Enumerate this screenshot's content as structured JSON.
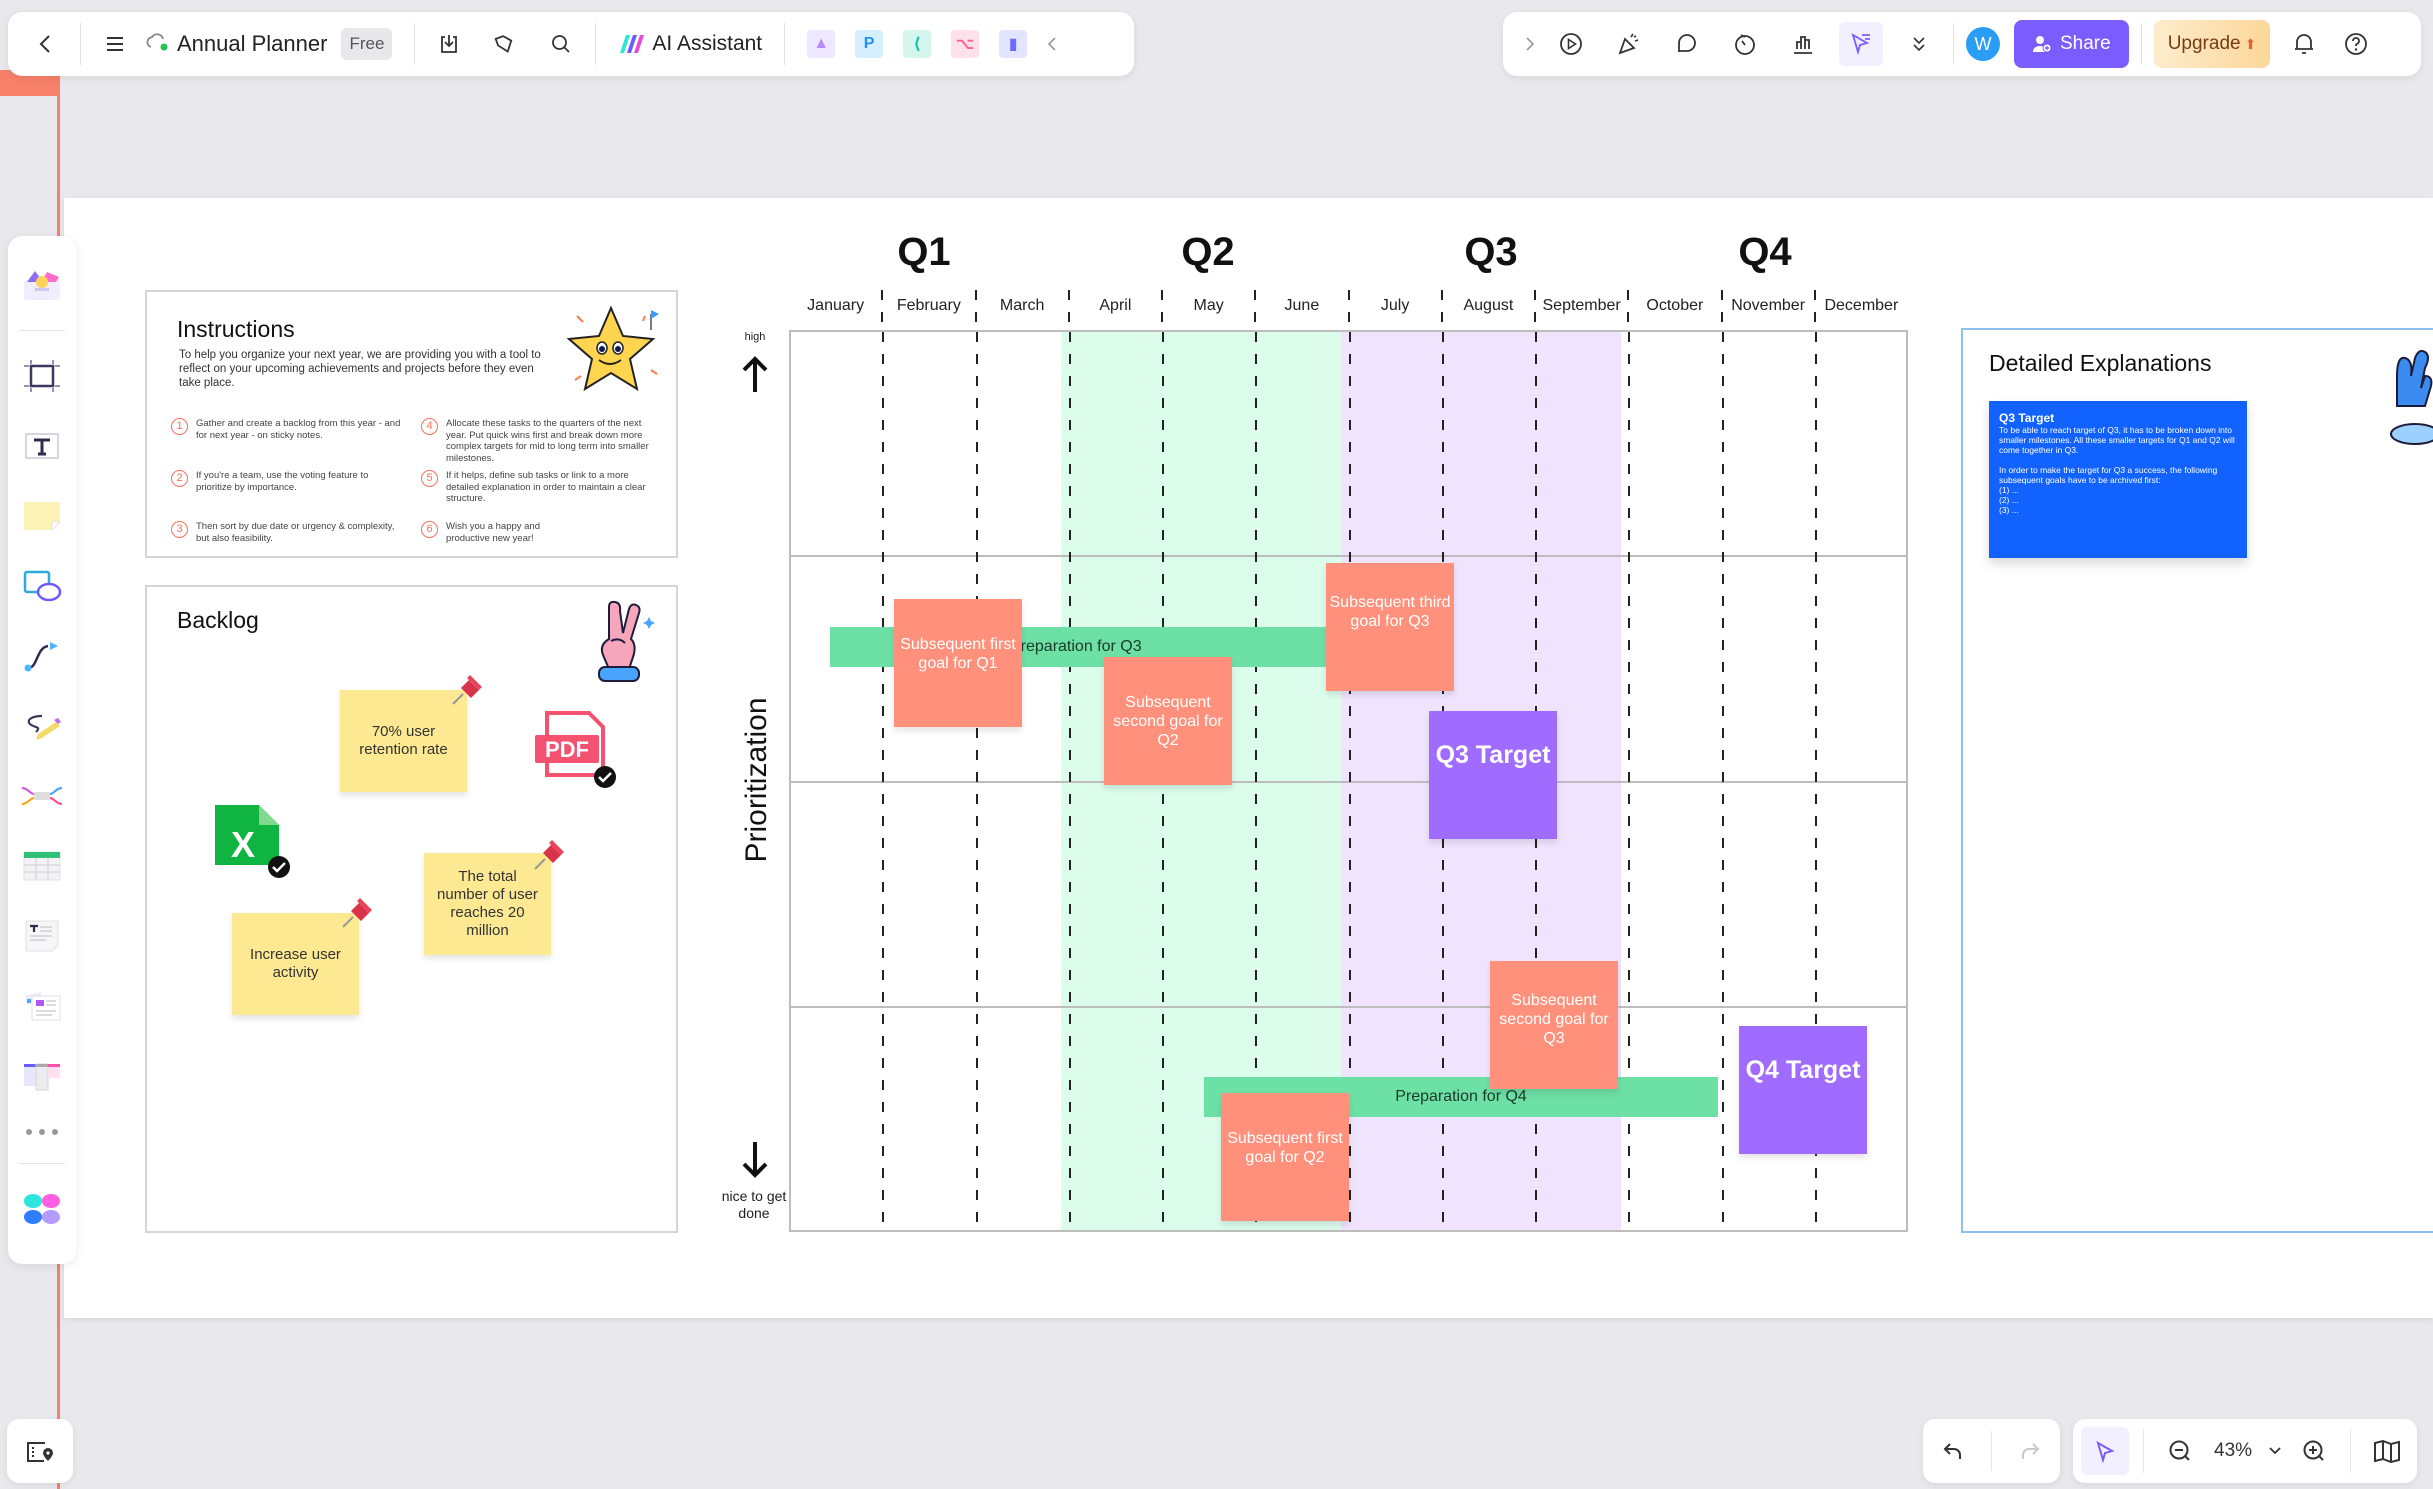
{
  "topbar": {
    "title": "Annual Planner",
    "badge": "Free",
    "ai_assistant": "AI Assistant",
    "avatar_initial": "W",
    "share": "Share",
    "upgrade": "Upgrade"
  },
  "instructions": {
    "title": "Instructions",
    "intro": "To help you organize your next year, we are providing you with a tool to reflect on your upcoming achievements and projects before they even take place.",
    "steps": [
      {
        "num": "1",
        "text": "Gather and create a backlog from this year - and for next year - on sticky notes."
      },
      {
        "num": "2",
        "text": "If you're a team, use the voting feature to prioritize by importance."
      },
      {
        "num": "3",
        "text": "Then sort by due date or urgency & complexity, but also feasibility."
      },
      {
        "num": "4",
        "text": "Allocate these tasks to the quarters of the next year. Put quick wins first and break down more complex targets for mid to long term into smaller milestones."
      },
      {
        "num": "5",
        "text": "If it helps, define sub tasks or link to a more detailed explanation in order to maintain a clear structure."
      },
      {
        "num": "6",
        "text": "Wish you a happy and productive new year!"
      }
    ]
  },
  "backlog": {
    "title": "Backlog",
    "notes": [
      "70% user retention rate",
      "The total number of user reaches 20 million",
      "Increase user activity"
    ],
    "pdf_label": "PDF",
    "xls_label": "X"
  },
  "planner": {
    "quarters": [
      "Q1",
      "Q2",
      "Q3",
      "Q4"
    ],
    "months": [
      "January",
      "February",
      "March",
      "April",
      "May",
      "June",
      "July",
      "August",
      "September",
      "October",
      "November",
      "December"
    ],
    "axis_label": "Prioritization",
    "axis_high": "high",
    "axis_low": "nice to get done",
    "bars": [
      "Preparation for Q3",
      "Preparation for Q4"
    ],
    "goals": [
      "Subsequent first goal for Q1",
      "Subsequent second goal for Q2",
      "Subsequent third goal for Q3",
      "Subsequent second goal for Q3",
      "Subsequent first goal for Q2"
    ],
    "targets": [
      "Q3 Target",
      "Q4 Target"
    ],
    "colors": {
      "q2_band": "#dcfcec",
      "q3_band": "#efe3fd",
      "bar": "#6de0a5",
      "goal": "#ff907b",
      "target": "#a06bff"
    }
  },
  "details": {
    "title": "Detailed Explanations",
    "card_title": "Q3 Target",
    "card_body": "To be able to reach target of Q3, it has to be broken down into smaller milestones. All these smaller targets for Q1 and Q2 will come together in Q3.\n\nIn order to make the target for Q3 a success, the following subsequent goals have to be archived first:\n(1) ...\n(2) ...\n(3) ..."
  },
  "zoom": {
    "level": "43%"
  }
}
